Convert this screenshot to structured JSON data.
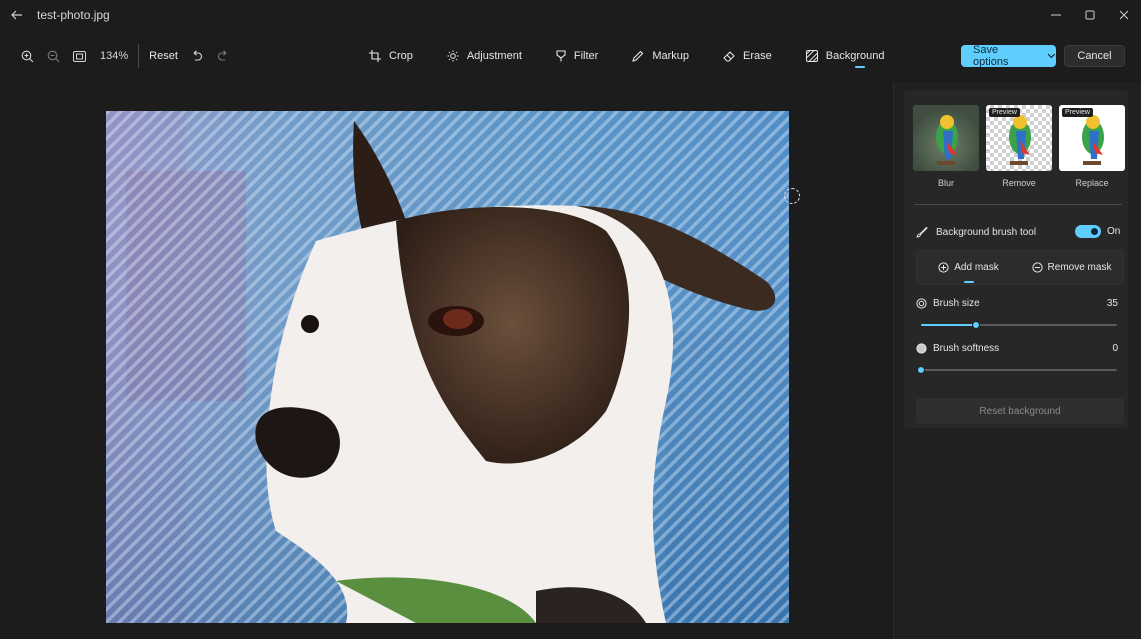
{
  "window": {
    "title": "test-photo.jpg",
    "back_icon": "back-arrow-icon",
    "controls": [
      "minimize-icon",
      "maximize-icon",
      "close-icon"
    ]
  },
  "toolbar": {
    "zoom_level": "134%",
    "reset_label": "Reset",
    "tabs": [
      {
        "label": "Crop",
        "icon": "crop-icon"
      },
      {
        "label": "Adjustment",
        "icon": "brightness-icon"
      },
      {
        "label": "Filter",
        "icon": "filter-icon"
      },
      {
        "label": "Markup",
        "icon": "pen-icon"
      },
      {
        "label": "Erase",
        "icon": "eraser-icon"
      },
      {
        "label": "Background",
        "icon": "background-icon",
        "active": true
      }
    ],
    "save_label": "Save options",
    "cancel_label": "Cancel"
  },
  "panel": {
    "presets": [
      {
        "label": "Blur",
        "tag": ""
      },
      {
        "label": "Remove",
        "tag": "Preview"
      },
      {
        "label": "Replace",
        "tag": "Preview"
      }
    ],
    "brush_tool": {
      "label": "Background brush tool",
      "state": "On",
      "enabled": true
    },
    "mask": {
      "add_label": "Add mask",
      "remove_label": "Remove mask",
      "active": "add"
    },
    "brush_size": {
      "label": "Brush size",
      "value": "35",
      "fraction": 0.28
    },
    "brush_softness": {
      "label": "Brush softness",
      "value": "0",
      "fraction": 0.0
    },
    "reset_background_label": "Reset background"
  },
  "colors": {
    "accent": "#60cdff",
    "background": "#1c1c1c",
    "panel": "#272727"
  }
}
